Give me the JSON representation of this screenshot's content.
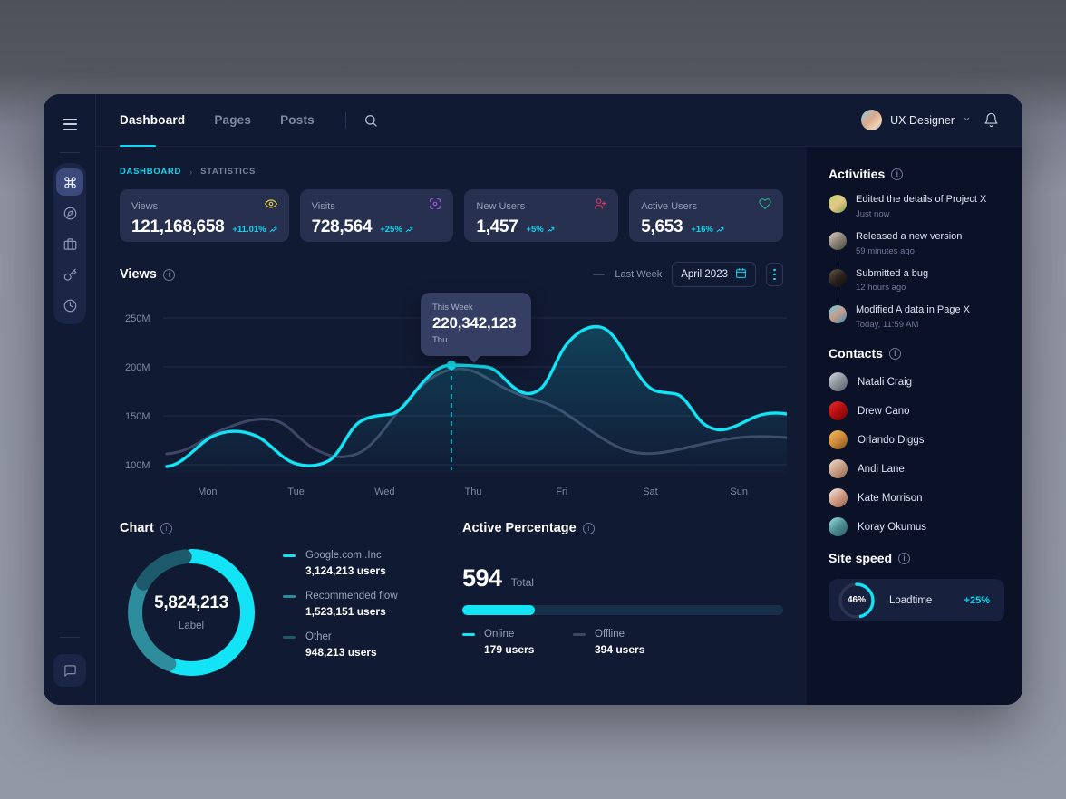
{
  "topnav": {
    "menu_icon": "hamburger-icon",
    "items": [
      {
        "label": "Dashboard",
        "active": true
      },
      {
        "label": "Pages",
        "active": false
      },
      {
        "label": "Posts",
        "active": false
      }
    ],
    "search_icon": "search-icon",
    "user": {
      "name": "UX Designer",
      "caret": "⌄"
    },
    "bell_icon": "bell-icon"
  },
  "rail": {
    "icons": [
      "command-icon",
      "compass-icon",
      "briefcase-icon",
      "key-icon",
      "clock-icon"
    ],
    "bottom_icon": "chat-icon"
  },
  "breadcrumb": {
    "current": "DASHBOARD",
    "separator": "›",
    "parent": "STATISTICS"
  },
  "stats": [
    {
      "label": "Views",
      "value": "121,168,658",
      "delta": "+11.01%",
      "icon": "eye-icon",
      "icon_color": "#e8d84a"
    },
    {
      "label": "Visits",
      "value": "728,564",
      "delta": "+25%",
      "icon": "scan-icon",
      "icon_color": "#a855f7"
    },
    {
      "label": "New Users",
      "value": "1,457",
      "delta": "+5%",
      "icon": "user-plus-icon",
      "icon_color": "#e0385f"
    },
    {
      "label": "Active Users",
      "value": "5,653",
      "delta": "+16%",
      "icon": "heart-icon",
      "icon_color": "#2fb98a"
    }
  ],
  "views_panel": {
    "title": "Views",
    "legend_label": "Last Week",
    "date_value": "April 2023",
    "calendar_icon": "calendar-icon",
    "kebab_icon": "more-vertical-icon",
    "tooltip": {
      "period": "This Week",
      "value": "220,342,123",
      "day": "Thu"
    }
  },
  "chart_data": {
    "type": "line",
    "title": "Views",
    "xlabel": "",
    "ylabel": "",
    "x": [
      "Mon",
      "Tue",
      "Wed",
      "Thu",
      "Fri",
      "Sat",
      "Sun"
    ],
    "ytick_labels": [
      "250M",
      "200M",
      "150M",
      "100M"
    ],
    "ylim": [
      75,
      270
    ],
    "grid": true,
    "legend_position": "top-right",
    "highlight": {
      "x": "Thu",
      "y": 220.342123,
      "label": "220,342,123"
    },
    "series": [
      {
        "name": "This Week",
        "color": "#12e3f5",
        "values": [
          112,
          148,
          144,
          118,
          122,
          160,
          165,
          220,
          220,
          196,
          208,
          248,
          238,
          185,
          183,
          145,
          150,
          152
        ]
      },
      {
        "name": "Last Week",
        "color": "#3e4765",
        "values": [
          122,
          128,
          152,
          140,
          120,
          124,
          150,
          178,
          196,
          203,
          188,
          166,
          150,
          140,
          136,
          142,
          148,
          150
        ]
      }
    ]
  },
  "donut_panel": {
    "title": "Chart",
    "center_value": "5,824,213",
    "center_label": "Label",
    "segments": [
      {
        "name": "Google.com .Inc",
        "users": "3,124,213 users",
        "color": "#12e3f5",
        "percent": 56
      },
      {
        "name": "Recommended flow",
        "users": "1,523,151 users",
        "color": "#2e8d9c",
        "percent": 27
      },
      {
        "name": "Other",
        "users": "948,213 users",
        "color": "#1d5a6b",
        "percent": 17
      }
    ]
  },
  "active_panel": {
    "title": "Active Percentage",
    "total_value": "594",
    "total_label": "Total",
    "progress_percent": 31,
    "legend": [
      {
        "name": "Online",
        "value": "179 users",
        "color": "#12e3f5"
      },
      {
        "name": "Offline",
        "value": "394 users",
        "color": "#3e4765"
      }
    ]
  },
  "activities": {
    "title": "Activities",
    "items": [
      {
        "text": "Edited the details of Project X",
        "time": "Just now",
        "avatar": "linear-gradient(140deg,#b9d46a,#e6c88a,#7d9e4a)"
      },
      {
        "text": "Released a new version",
        "time": "59 minutes ago",
        "avatar": "linear-gradient(140deg,#d8d3c8,#8b8376,#4a453d)"
      },
      {
        "text": "Submitted a bug",
        "time": "12 hours ago",
        "avatar": "linear-gradient(140deg,#6b5a48,#2b2420,#0e0c0a)"
      },
      {
        "text": "Modified A data in Page X",
        "time": "Today, 11:59 AM",
        "avatar": "linear-gradient(140deg,#62d4e8,#c99a8a,#3a8fb0)"
      }
    ]
  },
  "contacts": {
    "title": "Contacts",
    "items": [
      {
        "name": "Natali Craig",
        "avatar": "linear-gradient(140deg,#d9dde4,#8e939c,#5a5f68)"
      },
      {
        "name": "Drew Cano",
        "avatar": "linear-gradient(140deg,#ef2b2b,#b40f0f,#6a0606)"
      },
      {
        "name": "Orlando Diggs",
        "avatar": "linear-gradient(140deg,#f0c060,#d08b3a,#7a5120)"
      },
      {
        "name": "Andi Lane",
        "avatar": "linear-gradient(140deg,#efe0d4,#c79f85,#8c6a50)"
      },
      {
        "name": "Kate Morrison",
        "avatar": "linear-gradient(140deg,#f3ece6,#cf9d86,#9a5f48)"
      },
      {
        "name": "Koray Okumus",
        "avatar": "linear-gradient(140deg,#9fe5dd,#4f8f96,#2b5a63)"
      }
    ]
  },
  "site_speed": {
    "title": "Site speed",
    "percent_label": "46%",
    "percent": 46,
    "label": "Loadtime",
    "delta": "+25%"
  }
}
